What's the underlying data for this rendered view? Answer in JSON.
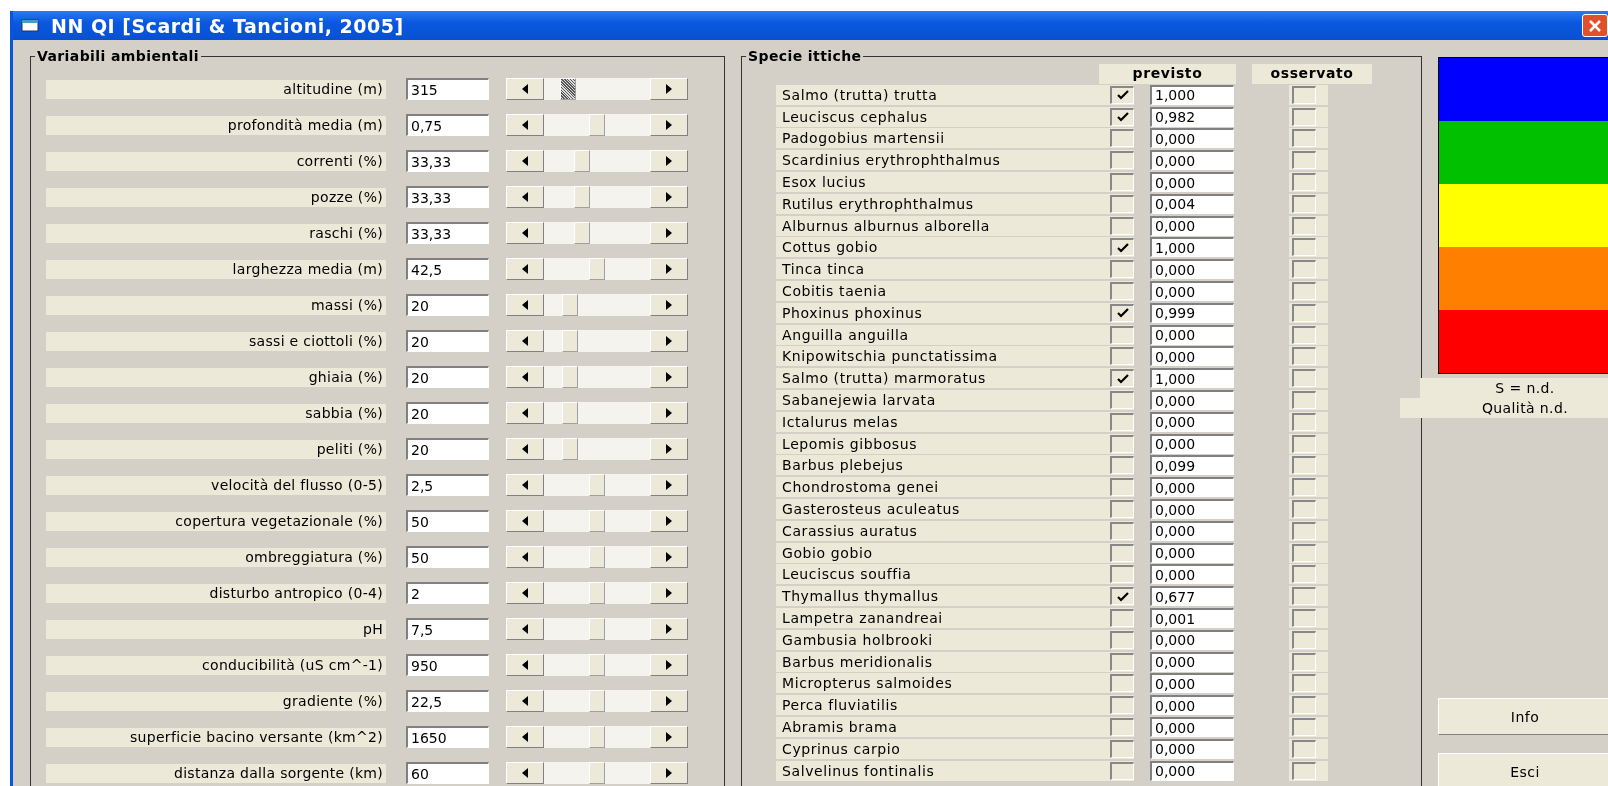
{
  "window": {
    "title": "NN QI [Scardi & Tancioni, 2005]"
  },
  "environmental_variables": {
    "title": "Variabili ambientali",
    "rows": [
      {
        "label": "altitudine (m)",
        "value": "315",
        "level": 0.18,
        "focused": true
      },
      {
        "label": "profondità media (m)",
        "value": "0,75",
        "level": 0.5,
        "focused": false
      },
      {
        "label": "correnti (%)",
        "value": "33,33",
        "level": 0.33,
        "focused": false
      },
      {
        "label": "pozze (%)",
        "value": "33,33",
        "level": 0.33,
        "focused": false
      },
      {
        "label": "raschi (%)",
        "value": "33,33",
        "level": 0.33,
        "focused": false
      },
      {
        "label": "larghezza media (m)",
        "value": "42,5",
        "level": 0.5,
        "focused": false
      },
      {
        "label": "massi (%)",
        "value": "20",
        "level": 0.2,
        "focused": false
      },
      {
        "label": "sassi e ciottoli (%)",
        "value": "20",
        "level": 0.2,
        "focused": false
      },
      {
        "label": "ghiaia (%)",
        "value": "20",
        "level": 0.2,
        "focused": false
      },
      {
        "label": "sabbia (%)",
        "value": "20",
        "level": 0.2,
        "focused": false
      },
      {
        "label": "peliti (%)",
        "value": "20",
        "level": 0.2,
        "focused": false
      },
      {
        "label": "velocità del flusso (0-5)",
        "value": "2,5",
        "level": 0.5,
        "focused": false
      },
      {
        "label": "copertura vegetazionale (%)",
        "value": "50",
        "level": 0.5,
        "focused": false
      },
      {
        "label": "ombreggiatura (%)",
        "value": "50",
        "level": 0.5,
        "focused": false
      },
      {
        "label": "disturbo antropico (0-4)",
        "value": "2",
        "level": 0.5,
        "focused": false
      },
      {
        "label": "pH",
        "value": "7,5",
        "level": 0.5,
        "focused": false
      },
      {
        "label": "conducibilità (uS cm^-1)",
        "value": "950",
        "level": 0.5,
        "focused": false
      },
      {
        "label": "gradiente (%)",
        "value": "22,5",
        "level": 0.5,
        "focused": false
      },
      {
        "label": "superficie bacino versante (km^2)",
        "value": "1650",
        "level": 0.5,
        "focused": false
      },
      {
        "label": "distanza dalla sorgente (km)",
        "value": "60",
        "level": 0.5,
        "focused": false
      }
    ]
  },
  "fish_species": {
    "title": "Specie ittiche",
    "columns": [
      "previsto",
      "osservato"
    ],
    "rows": [
      {
        "name": "Salmo (trutta) trutta",
        "predicted": true,
        "value": "1,000",
        "observed": false
      },
      {
        "name": "Leuciscus cephalus",
        "predicted": true,
        "value": "0,982",
        "observed": false
      },
      {
        "name": "Padogobius martensii",
        "predicted": false,
        "value": "0,000",
        "observed": false
      },
      {
        "name": "Scardinius erythrophthalmus",
        "predicted": false,
        "value": "0,000",
        "observed": false
      },
      {
        "name": "Esox lucius",
        "predicted": false,
        "value": "0,000",
        "observed": false
      },
      {
        "name": "Rutilus erythrophthalmus",
        "predicted": false,
        "value": "0,004",
        "observed": false
      },
      {
        "name": "Alburnus alburnus alborella",
        "predicted": false,
        "value": "0,000",
        "observed": false
      },
      {
        "name": "Cottus gobio",
        "predicted": true,
        "value": "1,000",
        "observed": false
      },
      {
        "name": "Tinca tinca",
        "predicted": false,
        "value": "0,000",
        "observed": false
      },
      {
        "name": "Cobitis taenia",
        "predicted": false,
        "value": "0,000",
        "observed": false
      },
      {
        "name": "Phoxinus phoxinus",
        "predicted": true,
        "value": "0,999",
        "observed": false
      },
      {
        "name": "Anguilla anguilla",
        "predicted": false,
        "value": "0,000",
        "observed": false
      },
      {
        "name": "Knipowitschia punctatissima",
        "predicted": false,
        "value": "0,000",
        "observed": false
      },
      {
        "name": "Salmo (trutta) marmoratus",
        "predicted": true,
        "value": "1,000",
        "observed": false
      },
      {
        "name": "Sabanejewia larvata",
        "predicted": false,
        "value": "0,000",
        "observed": false
      },
      {
        "name": "Ictalurus melas",
        "predicted": false,
        "value": "0,000",
        "observed": false
      },
      {
        "name": "Lepomis gibbosus",
        "predicted": false,
        "value": "0,000",
        "observed": false
      },
      {
        "name": "Barbus plebejus",
        "predicted": false,
        "value": "0,099",
        "observed": false
      },
      {
        "name": "Chondrostoma genei",
        "predicted": false,
        "value": "0,000",
        "observed": false
      },
      {
        "name": "Gasterosteus aculeatus",
        "predicted": false,
        "value": "0,000",
        "observed": false
      },
      {
        "name": "Carassius auratus",
        "predicted": false,
        "value": "0,000",
        "observed": false
      },
      {
        "name": "Gobio gobio",
        "predicted": false,
        "value": "0,000",
        "observed": false
      },
      {
        "name": "Leuciscus souffia",
        "predicted": false,
        "value": "0,000",
        "observed": false
      },
      {
        "name": "Thymallus thymallus",
        "predicted": true,
        "value": "0,677",
        "observed": false
      },
      {
        "name": "Lampetra zanandreai",
        "predicted": false,
        "value": "0,001",
        "observed": false
      },
      {
        "name": "Gambusia holbrooki",
        "predicted": false,
        "value": "0,000",
        "observed": false
      },
      {
        "name": "Barbus meridionalis",
        "predicted": false,
        "value": "0,000",
        "observed": false
      },
      {
        "name": "Micropterus salmoides",
        "predicted": false,
        "value": "0,000",
        "observed": false
      },
      {
        "name": "Perca fluviatilis",
        "predicted": false,
        "value": "0,000",
        "observed": false
      },
      {
        "name": "Abramis brama",
        "predicted": false,
        "value": "0,000",
        "observed": false
      },
      {
        "name": "Cyprinus carpio",
        "predicted": false,
        "value": "0,000",
        "observed": false
      },
      {
        "name": "Salvelinus fontinalis",
        "predicted": false,
        "value": "0,000",
        "observed": false
      }
    ]
  },
  "quality": {
    "scale": [
      {
        "color": "#0000ff"
      },
      {
        "color": "#00c000"
      },
      {
        "color": "#ffff00"
      },
      {
        "color": "#ff8000"
      },
      {
        "color": "#ff0000"
      }
    ],
    "lines": [
      "S = n.d.",
      "Qualità n.d."
    ]
  },
  "buttons": [
    "Info",
    "Esci"
  ]
}
